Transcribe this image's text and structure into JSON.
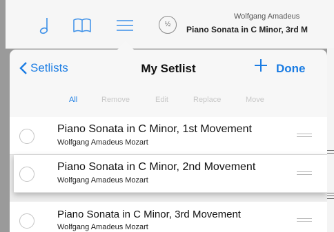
{
  "toolbar": {
    "icons": [
      "note-icon",
      "book-icon",
      "list-icon"
    ],
    "page_badge": "½",
    "composer": "Wolfgang Amadeus",
    "title": "Piano Sonata in C Minor, 3rd M"
  },
  "popover": {
    "back_label": "Setlists",
    "title": "My Setlist",
    "done_label": "Done",
    "segments": [
      {
        "label": "All",
        "active": true
      },
      {
        "label": "Remove",
        "active": false
      },
      {
        "label": "Edit",
        "active": false
      },
      {
        "label": "Replace",
        "active": false
      },
      {
        "label": "Move",
        "active": false
      }
    ],
    "items": [
      {
        "title": "Piano Sonata in C Minor, 1st Movement",
        "composer": "Wolfgang Amadeus Mozart"
      },
      {
        "title": "Piano Sonata in C Minor, 2nd Movement",
        "composer": "Wolfgang Amadeus Mozart"
      },
      {
        "title": "Piano Sonata in C Minor, 3rd Movement",
        "composer": "Wolfgang Amadeus Mozart"
      }
    ]
  },
  "colors": {
    "accent": "#1a7ce3",
    "toolbar_icon": "#3b8fe8"
  }
}
